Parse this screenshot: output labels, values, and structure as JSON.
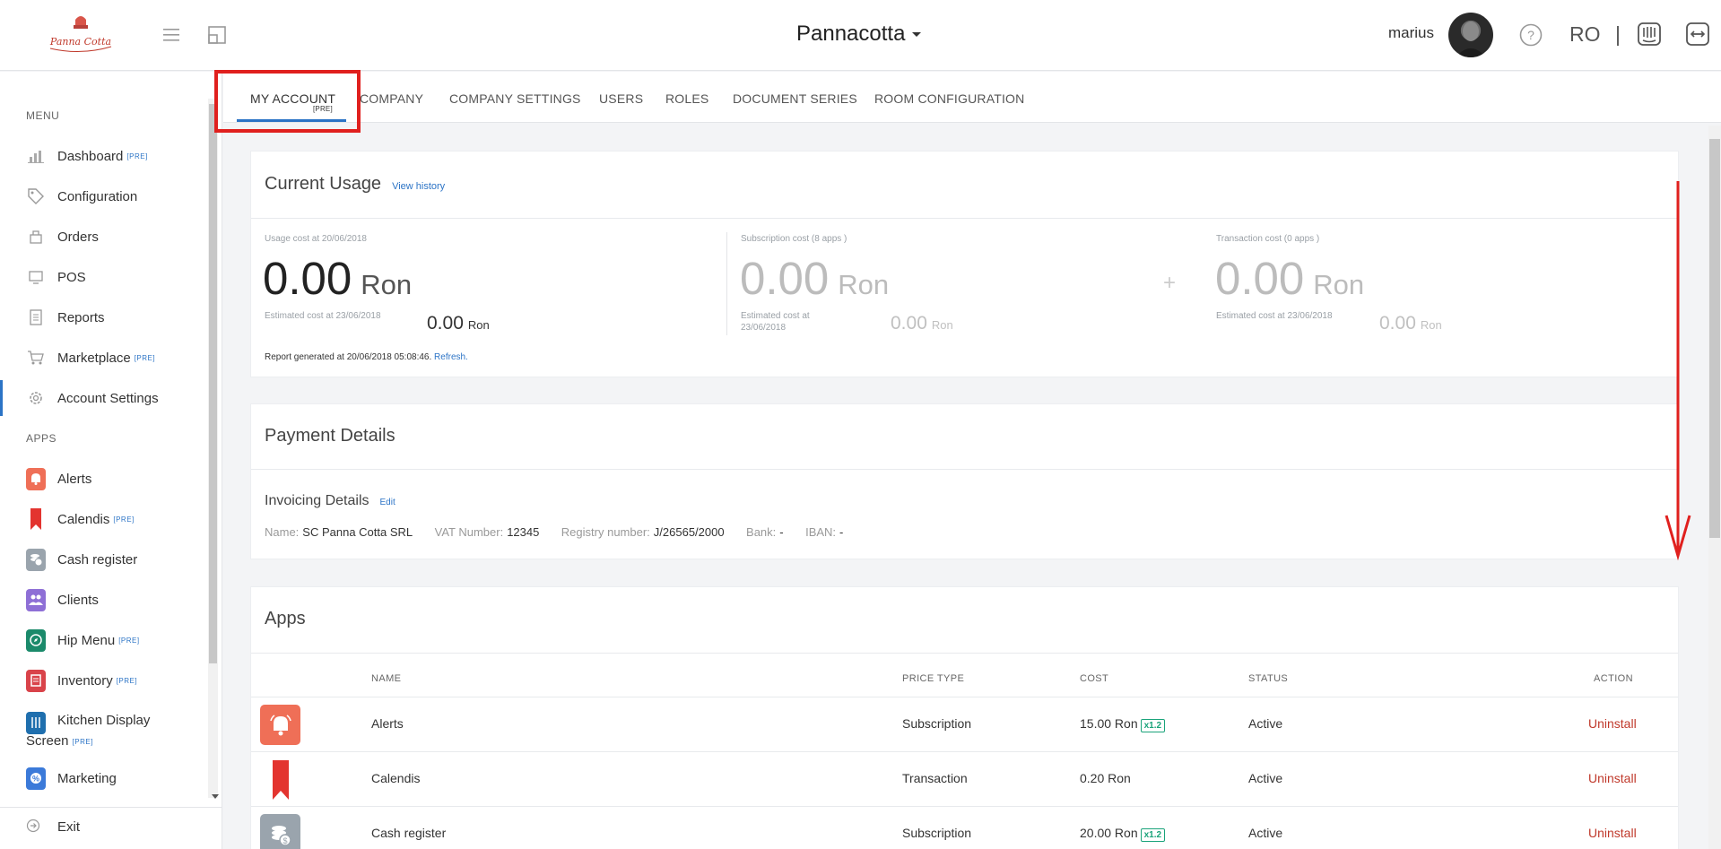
{
  "header": {
    "company": "Pannacotta",
    "username": "marius",
    "language": "RO",
    "separator": "|",
    "logo_text": "Panna Cotta"
  },
  "sidebar": {
    "menu_title": "MENU",
    "apps_title": "APPS",
    "pre_tag": "[PRE]",
    "menu_items": [
      {
        "label": "Dashboard",
        "pre": true,
        "icon": "bar-chart-icon"
      },
      {
        "label": "Configuration",
        "pre": false,
        "icon": "tag-icon"
      },
      {
        "label": "Orders",
        "pre": false,
        "icon": "orders-icon"
      },
      {
        "label": "POS",
        "pre": false,
        "icon": "monitor-icon"
      },
      {
        "label": "Reports",
        "pre": false,
        "icon": "document-icon"
      },
      {
        "label": "Marketplace",
        "pre": true,
        "icon": "cart-icon"
      },
      {
        "label": "Account Settings",
        "pre": false,
        "icon": "gear-icon",
        "active": true
      }
    ],
    "app_items": [
      {
        "label": "Alerts",
        "pre": false,
        "icon": "bell-icon",
        "color": "#ef6f57"
      },
      {
        "label": "Calendis",
        "pre": true,
        "icon": "bookmark-icon",
        "color": "#e3342f"
      },
      {
        "label": "Cash register",
        "pre": false,
        "icon": "coins-icon",
        "color": "#9aa4ad"
      },
      {
        "label": "Clients",
        "pre": false,
        "icon": "users-icon",
        "color": "#8e6fd6"
      },
      {
        "label": "Hip Menu",
        "pre": true,
        "icon": "compass-icon",
        "color": "#1b8a6b"
      },
      {
        "label": "Inventory",
        "pre": true,
        "icon": "inventory-icon",
        "color": "#d9434a"
      },
      {
        "label": "Kitchen Display",
        "label2": "Screen",
        "pre": true,
        "icon": "cutlery-icon",
        "color": "#1f6fae"
      },
      {
        "label": "Marketing",
        "pre": false,
        "icon": "percent-icon",
        "color": "#3b7ad9"
      }
    ],
    "exit": "Exit"
  },
  "tabs": [
    {
      "label": "MY ACCOUNT",
      "pre": "[PRE]",
      "active": true
    },
    {
      "label": "COMPANY"
    },
    {
      "label": "COMPANY SETTINGS"
    },
    {
      "label": "USERS"
    },
    {
      "label": "ROLES"
    },
    {
      "label": "DOCUMENT SERIES"
    },
    {
      "label": "ROOM CONFIGURATION"
    }
  ],
  "usage": {
    "title": "Current Usage",
    "history_link": "View history",
    "usage_label": "Usage cost at 20/06/2018",
    "usage_value": "0.00",
    "currency": "Ron",
    "usage_est_label": "Estimated cost at 23/06/2018",
    "usage_est_value": "0.00",
    "sub_label": "Subscription cost (8 apps )",
    "sub_value": "0.00",
    "sub_est_label_1": "Estimated cost at",
    "sub_est_label_2": "23/06/2018",
    "sub_est_value": "0.00",
    "plus": "+",
    "trans_label": "Transaction cost (0 apps )",
    "trans_value": "0.00",
    "trans_est_label": "Estimated cost at 23/06/2018",
    "trans_est_value": "0.00",
    "report_text": "Report generated at 20/06/2018 05:08:46.",
    "refresh": "Refresh."
  },
  "payment": {
    "title": "Payment Details",
    "invoicing_title": "Invoicing Details",
    "edit": "Edit",
    "name_label": "Name:",
    "name_value": "SC Panna Cotta SRL",
    "vat_label": "VAT Number:",
    "vat_value": "12345",
    "reg_label": "Registry number:",
    "reg_value": "J/26565/2000",
    "bank_label": "Bank:",
    "bank_value": "-",
    "iban_label": "IBAN:",
    "iban_value": "-"
  },
  "apps": {
    "title": "Apps",
    "columns": [
      "NAME",
      "PRICE TYPE",
      "COST",
      "STATUS",
      "ACTION"
    ],
    "rows": [
      {
        "name": "Alerts",
        "price_type": "Subscription",
        "cost": "15.00 Ron",
        "mult": "x1.2",
        "status": "Active",
        "action": "Uninstall",
        "icon": "bell-icon",
        "color": "#ef6f57"
      },
      {
        "name": "Calendis",
        "price_type": "Transaction",
        "cost": "0.20 Ron",
        "mult": "",
        "status": "Active",
        "action": "Uninstall",
        "icon": "bookmark-icon",
        "color": "#e3342f"
      },
      {
        "name": "Cash register",
        "price_type": "Subscription",
        "cost": "20.00 Ron",
        "mult": "x1.2",
        "status": "Active",
        "action": "Uninstall",
        "icon": "coins-icon",
        "color": "#9aa4ad"
      }
    ]
  },
  "colors": {
    "accent": "#2c74c6",
    "highlight": "#e0201e",
    "danger": "#c0392b",
    "success": "#1aa37a"
  }
}
